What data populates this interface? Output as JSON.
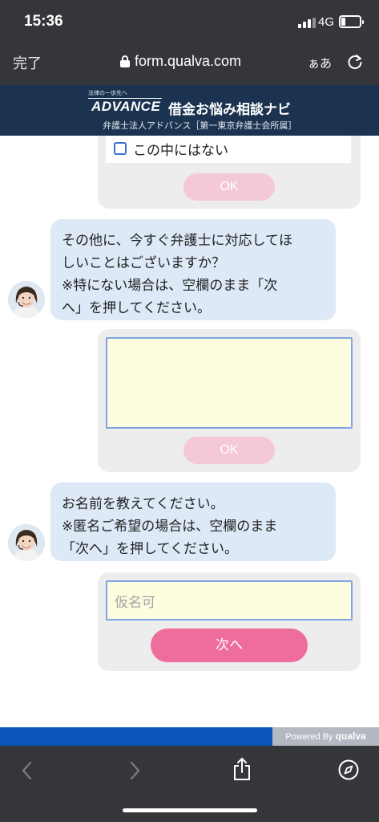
{
  "status_bar": {
    "time": "15:36",
    "network": "4G"
  },
  "browser": {
    "done_label": "完了",
    "url": "form.qualva.com",
    "text_size_label": "ぁあ",
    "icons": [
      "lock-icon",
      "reload-icon",
      "back-icon",
      "forward-icon",
      "share-icon",
      "compass-icon"
    ]
  },
  "site_header": {
    "tagline": "法律の一歩先へ",
    "brand": "ADVANCE",
    "title": "借金お悩み相談ナビ",
    "subtitle": "弁護士法人アドバンス［第一東京弁護士会所属］"
  },
  "chat": {
    "choice_block": {
      "option_label": "この中にはない",
      "ok_label": "OK"
    },
    "question_other": {
      "lines": [
        "その他に、今すぐ弁護士に対応してほ",
        "しいことはございますか？",
        "※特にない場合は、空欄のまま「次",
        "へ」を押してください。"
      ]
    },
    "free_text_block": {
      "value": "",
      "ok_label": "OK"
    },
    "question_name": {
      "lines": [
        "お名前を教えてください。",
        "※匿名ご希望の場合は、空欄のまま",
        "「次へ」を押してください。"
      ]
    },
    "name_block": {
      "value": "",
      "placeholder": "仮名可",
      "next_label": "次へ"
    }
  },
  "powered_by": {
    "prefix": "Powered By ",
    "brand": "qualva"
  },
  "colors": {
    "header_bg": "#1b3350",
    "bubble_bg": "#dde9f7",
    "next_button": "#ee6d9c",
    "ok_button_disabled": "#f4c8d8",
    "input_bg": "#fdfde0",
    "powered_bar": "#0a55b8"
  }
}
